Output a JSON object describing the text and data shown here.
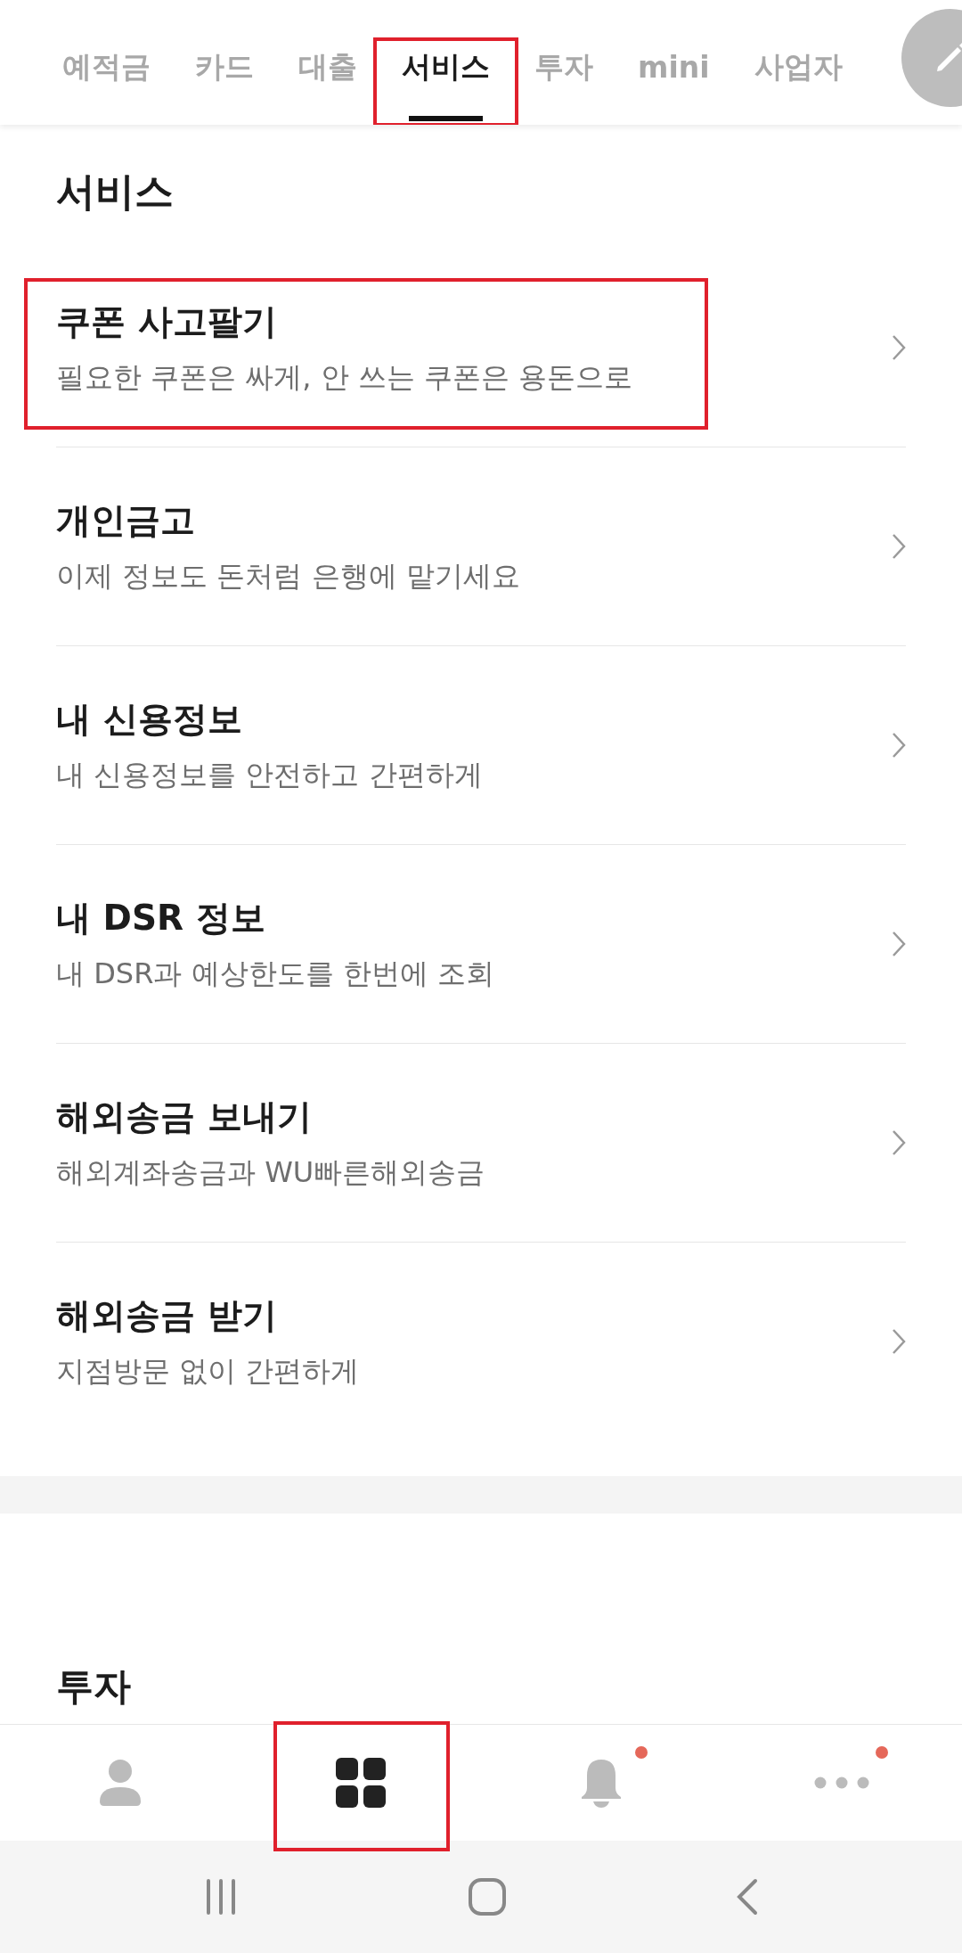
{
  "tabs": [
    {
      "label": "예적금",
      "selected": false,
      "highlighted": false
    },
    {
      "label": "카드",
      "selected": false,
      "highlighted": false
    },
    {
      "label": "대출",
      "selected": false,
      "highlighted": false
    },
    {
      "label": "서비스",
      "selected": true,
      "highlighted": true
    },
    {
      "label": "투자",
      "selected": false,
      "highlighted": false
    },
    {
      "label": "mini",
      "selected": false,
      "highlighted": false
    },
    {
      "label": "사업자",
      "selected": false,
      "highlighted": false
    }
  ],
  "section": {
    "title": "서비스",
    "items": [
      {
        "title": "쿠폰 사고팔기",
        "subtitle": "필요한 쿠폰은 싸게, 안 쓰는 쿠폰은 용돈으로",
        "highlighted": true
      },
      {
        "title": "개인금고",
        "subtitle": "이제 정보도 돈처럼 은행에 맡기세요",
        "highlighted": false
      },
      {
        "title": "내 신용정보",
        "subtitle": "내 신용정보를 안전하고 간편하게",
        "highlighted": false
      },
      {
        "title": "내 DSR 정보",
        "subtitle": "내 DSR과 예상한도를 한번에 조회",
        "highlighted": false
      },
      {
        "title": "해외송금 보내기",
        "subtitle": "해외계좌송금과 WU빠른해외송금",
        "highlighted": false
      },
      {
        "title": "해외송금 받기",
        "subtitle": "지점방문 없이 간편하게",
        "highlighted": false
      }
    ]
  },
  "next_section": {
    "title": "투자"
  },
  "bottom_nav": [
    {
      "kind": "profile",
      "selected": false,
      "badge": false,
      "highlighted": false
    },
    {
      "kind": "grid",
      "selected": true,
      "badge": false,
      "highlighted": true
    },
    {
      "kind": "bell",
      "selected": false,
      "badge": true,
      "highlighted": false
    },
    {
      "kind": "more",
      "selected": false,
      "badge": true,
      "highlighted": false
    }
  ]
}
